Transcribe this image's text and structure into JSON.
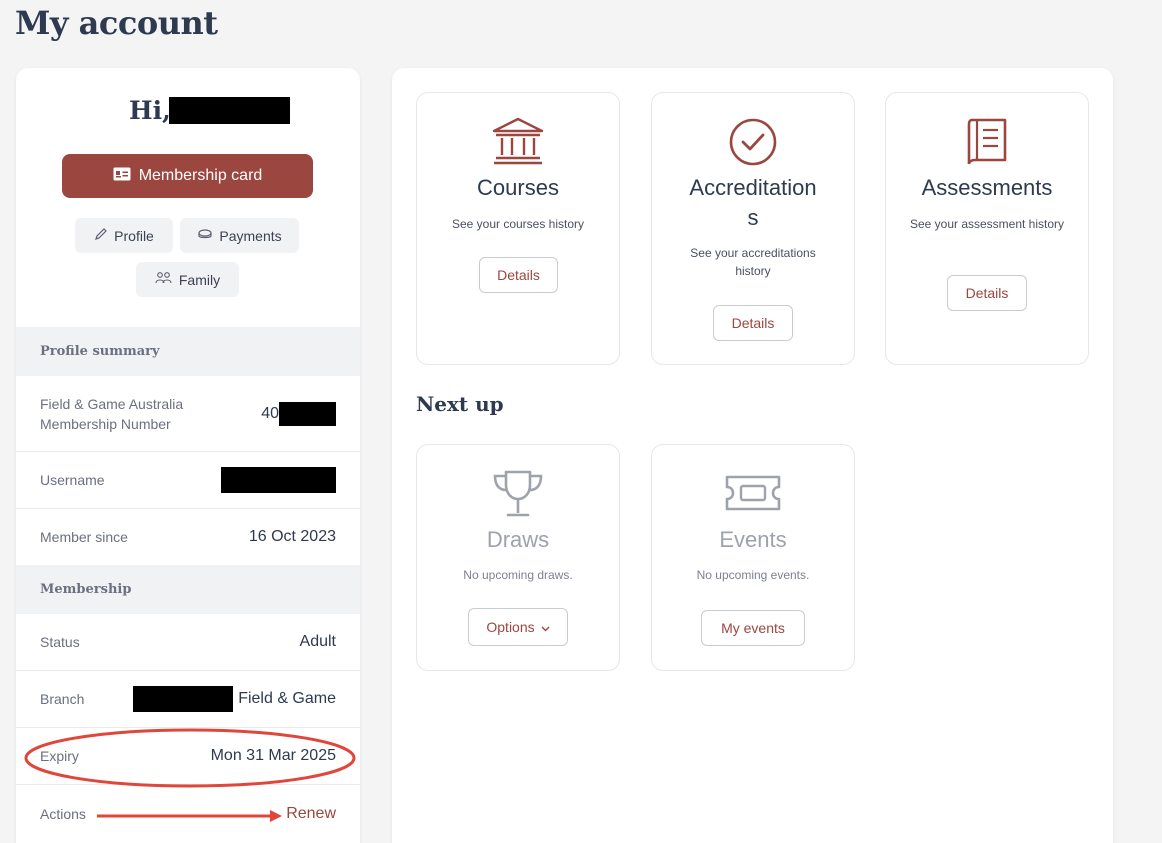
{
  "page": {
    "title": "My account"
  },
  "profile": {
    "greeting": "Hi,",
    "membership_card_label": "Membership card",
    "buttons": {
      "profile": "Profile",
      "payments": "Payments",
      "family": "Family"
    }
  },
  "summary": {
    "heading": "Profile summary",
    "membership_number_label": "Field & Game Australia Membership Number",
    "membership_number_prefix": "40",
    "username_label": "Username",
    "member_since_label": "Member since",
    "member_since_value": "16 Oct 2023"
  },
  "membership": {
    "heading": "Membership",
    "status_label": "Status",
    "status_value": "Adult",
    "branch_label": "Branch",
    "branch_value": "Field & Game",
    "expiry_label": "Expiry",
    "expiry_value": "Mon 31 Mar 2025",
    "actions_label": "Actions",
    "renew_label": "Renew"
  },
  "cards": {
    "courses": {
      "title": "Courses",
      "desc": "See your courses history",
      "button": "Details"
    },
    "accreditations": {
      "title_line1": "Accreditation",
      "title_line2": "s",
      "desc": "See your accreditations history",
      "button": "Details"
    },
    "assessments": {
      "title": "Assessments",
      "desc": "See your assessment history",
      "button": "Details"
    }
  },
  "next_up": {
    "heading": "Next up",
    "draws": {
      "title": "Draws",
      "desc": "No upcoming draws.",
      "button": "Options"
    },
    "events": {
      "title": "Events",
      "desc": "No upcoming events.",
      "button": "My events"
    }
  },
  "colors": {
    "accent": "#9c4640",
    "annotation": "#e0463a",
    "heading": "#2e3a50"
  },
  "icons": [
    "id-card-icon",
    "pencil-icon",
    "coins-icon",
    "family-icon",
    "bank-icon",
    "check-circle-icon",
    "book-icon",
    "trophy-icon",
    "ticket-icon",
    "chevron-down-icon"
  ]
}
